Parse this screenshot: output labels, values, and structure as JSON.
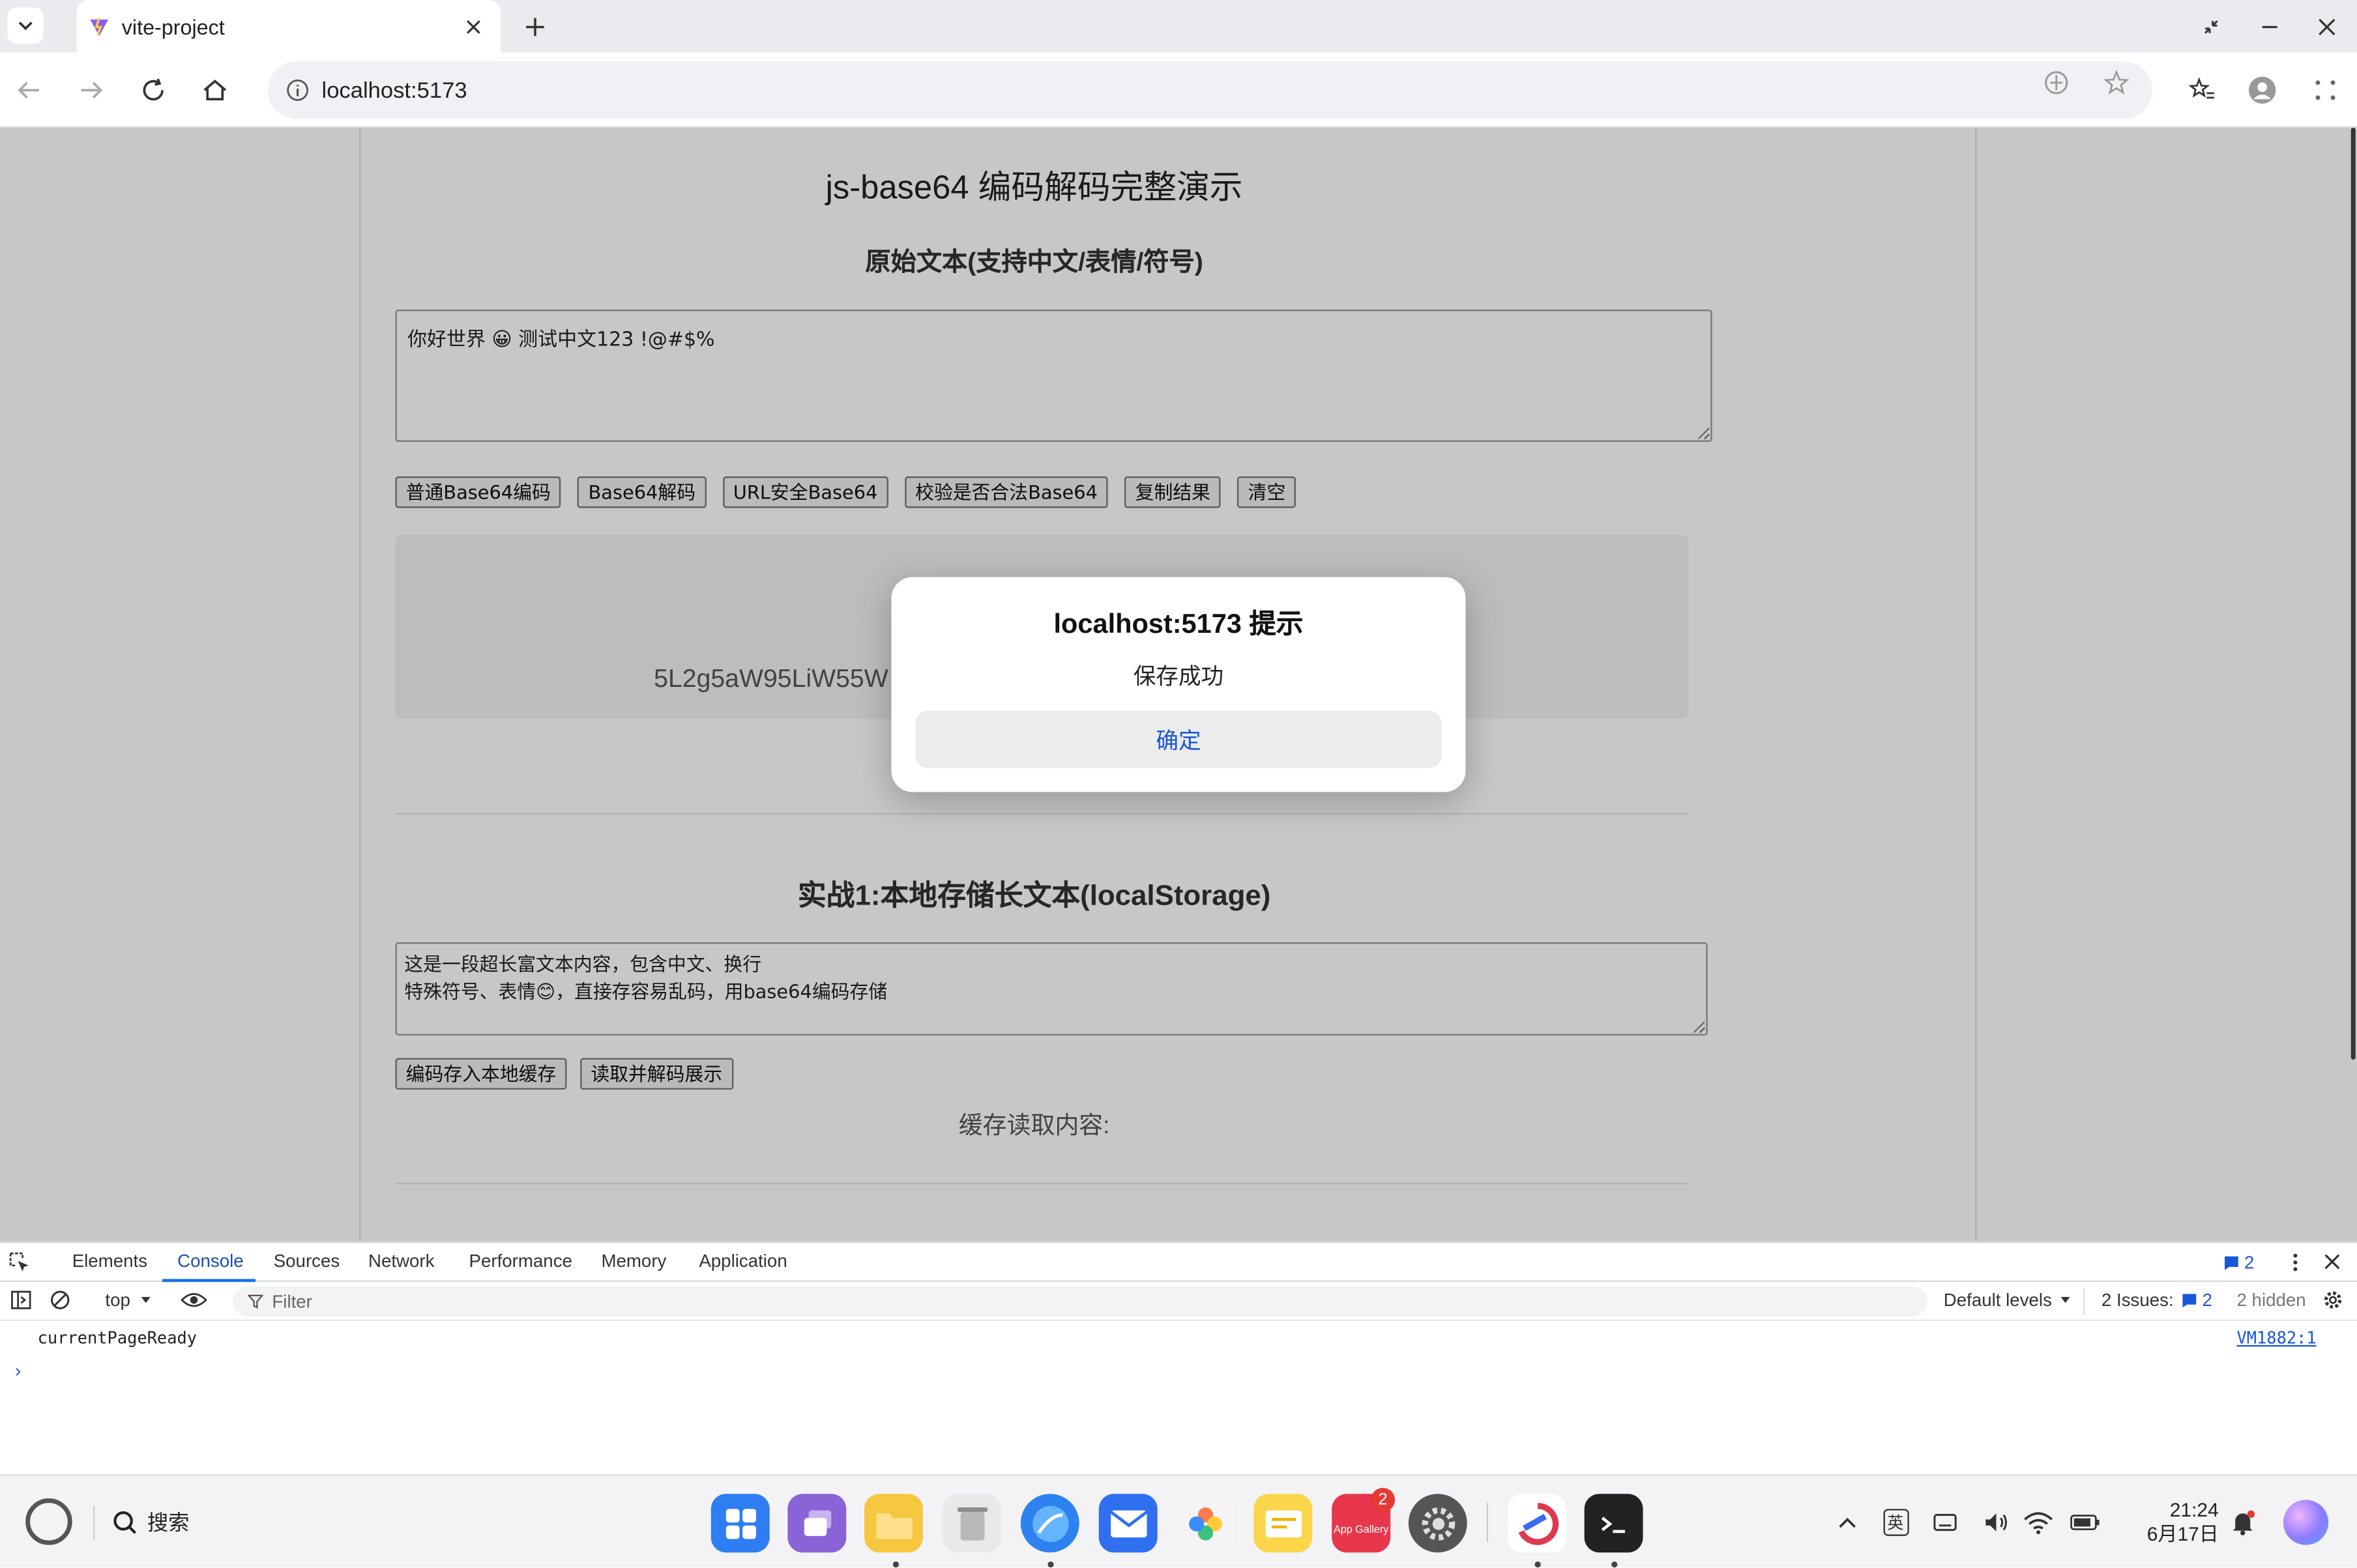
{
  "browser": {
    "tab_title": "vite-project",
    "url": "localhost:5173"
  },
  "page": {
    "title": "js-base64 编码解码完整演示",
    "section1_heading": "原始文本(支持中文/表情/符号)",
    "input_text": "你好世界 😀 测试中文123 !@#$%",
    "buttons": [
      "普通Base64编码",
      "Base64解码",
      "URL安全Base64",
      "校验是否合法Base64",
      "复制结果",
      "清空"
    ],
    "result_text": "5L2g5aW95LiW55W",
    "section2_heading": "实战1:本地存储长文本(localStorage)",
    "storage_text": "这是一段超长富文本内容，包含中文、换行\n特殊符号、表情😊，直接存容易乱码，用base64编码存储",
    "storage_buttons": [
      "编码存入本地缓存",
      "读取并解码展示"
    ],
    "cache_label": "缓存读取内容:"
  },
  "dialog": {
    "title": "localhost:5173 提示",
    "message": "保存成功",
    "ok_label": "确定"
  },
  "devtools": {
    "tabs": [
      "Elements",
      "Console",
      "Sources",
      "Network",
      "Performance",
      "Memory",
      "Application"
    ],
    "active_tab": "Console",
    "issue_count_top": "2",
    "context": "top",
    "filter_placeholder": "Filter",
    "levels": "Default levels",
    "issues_label": "2 Issues:",
    "issues_count": "2",
    "hidden": "2 hidden",
    "log_message": "currentPageReady",
    "log_source": "VM1882:1"
  },
  "taskbar": {
    "search_label": "搜索",
    "app_gallery_badge": "2",
    "app_gallery_label": "App Gallery",
    "ime": "英",
    "time": "21:24",
    "date": "6月17日"
  },
  "colors": {
    "accent": "#1a73e8",
    "dialog_button_text": "#1a56d6",
    "overlay": "rgba(0,0,0,0.22)"
  }
}
